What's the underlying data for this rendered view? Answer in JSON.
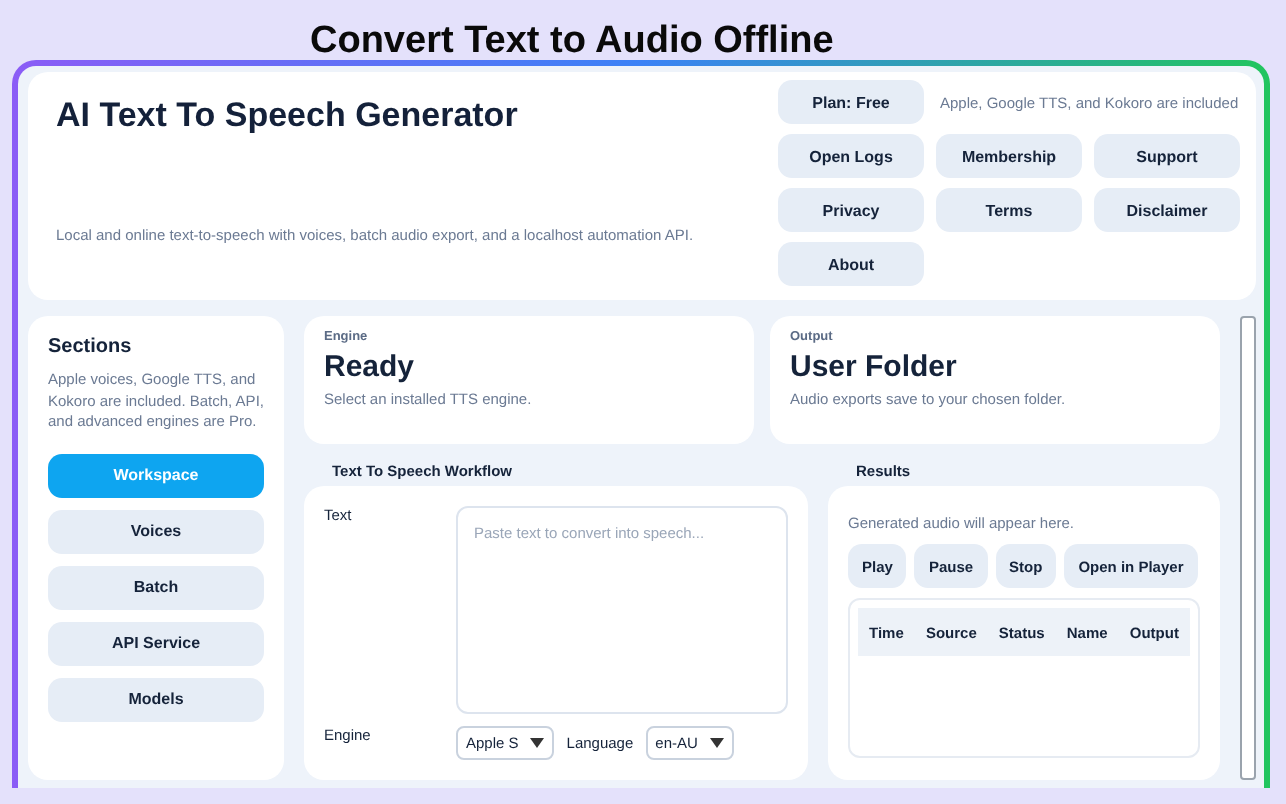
{
  "headline": "Convert Text to Audio Offline",
  "app": {
    "title": "AI Text To Speech Generator",
    "subtitle": "Local and online text-to-speech with voices, batch audio export, and a localhost automation API.",
    "plan": "Plan: Free",
    "plan_note": "Apple, Google TTS, and Kokoro are included",
    "buttons": [
      "Open Logs",
      "Membership",
      "Support",
      "Privacy",
      "Terms",
      "Disclaimer",
      "About"
    ]
  },
  "sidebar": {
    "title": "Sections",
    "note": "Apple voices, Google TTS, and Kokoro are included. Batch, API, and advanced engines are Pro.",
    "items": [
      {
        "label": "Workspace",
        "selected": true
      },
      {
        "label": "Voices",
        "selected": false
      },
      {
        "label": "Batch",
        "selected": false
      },
      {
        "label": "API Service",
        "selected": false
      },
      {
        "label": "Models",
        "selected": false
      }
    ]
  },
  "status_cards": [
    {
      "label": "Engine",
      "value": "Ready",
      "note": "Select an installed TTS engine."
    },
    {
      "label": "Output",
      "value": "User Folder",
      "note": "Audio exports save to your chosen folder."
    }
  ],
  "workflow": {
    "title": "Text To Speech Workflow",
    "text_label": "Text",
    "placeholder": "Paste text to convert into speech...",
    "engine_label": "Engine",
    "engine_value": "Apple S",
    "language_label": "Language",
    "language_value": "en-AU"
  },
  "results": {
    "title": "Results",
    "empty_note": "Generated audio will appear here.",
    "buttons": [
      "Play",
      "Pause",
      "Stop",
      "Open in Player"
    ],
    "columns": [
      "Time",
      "Source",
      "Status",
      "Name",
      "Output"
    ]
  }
}
